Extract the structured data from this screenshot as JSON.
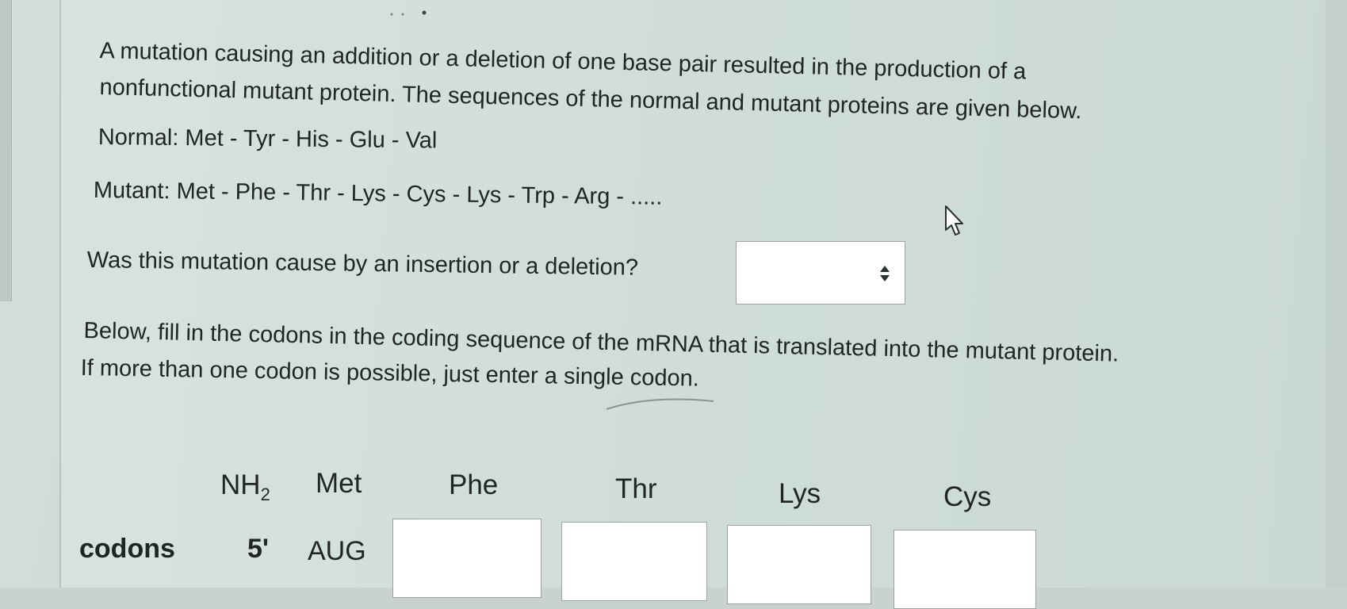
{
  "question": {
    "paragraph_line1": "A mutation causing an addition or a deletion of one base pair resulted in the production of a",
    "paragraph_line2": "nonfunctional mutant protein. The sequences of the normal and mutant proteins are given below.",
    "normal": "Normal: Met - Tyr - His - Glu - Val",
    "mutant": "Mutant: Met - Phe - Thr - Lys - Cys - Lys - Trp - Arg - .....",
    "prompt": "Was this mutation cause by an insertion or a deletion?",
    "select_value": "",
    "instructions_line1": "Below, fill in the codons in the coding sequence of the mRNA that is translated into the mutant protein.",
    "instructions_line2": "If more than one codon is possible, just enter a single codon."
  },
  "table": {
    "nh2_main": "NH",
    "nh2_sub": "2",
    "amino_acids": [
      "Met",
      "Phe",
      "Thr",
      "Lys",
      "Cys"
    ],
    "codons_label": "codons",
    "five_prime": "5'",
    "first_codon": "AUG",
    "codon_inputs": [
      "",
      "",
      "",
      ""
    ]
  },
  "icons": {
    "select_arrows": "up-down-arrows-icon",
    "cursor": "mouse-pointer-icon"
  }
}
